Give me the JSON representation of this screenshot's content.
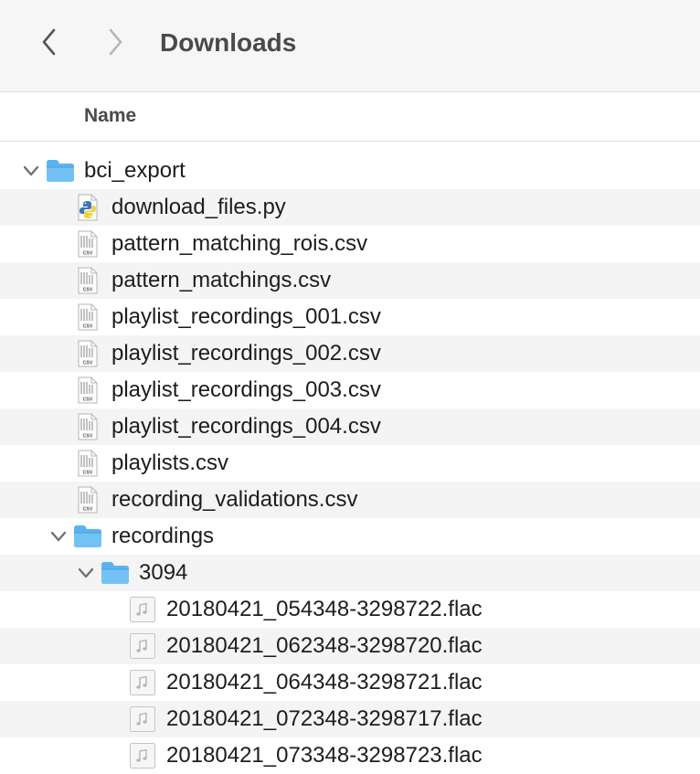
{
  "window": {
    "title": "Downloads"
  },
  "toolbar": {
    "back_icon": "chevron-left-icon",
    "forward_icon": "chevron-right-icon"
  },
  "columns": {
    "name": "Name"
  },
  "colors": {
    "folder": "#5ab3f0",
    "row_alt": "#f4f4f5",
    "toolbar_bg": "#f6f6f6"
  },
  "rows": [
    {
      "name": "bci_export",
      "kind": "folder",
      "level": 0,
      "expanded": true,
      "icon": "folder-icon"
    },
    {
      "name": "download_files.py",
      "kind": "python",
      "level": 1,
      "icon": "python-file-icon"
    },
    {
      "name": "pattern_matching_rois.csv",
      "kind": "csv",
      "level": 1,
      "icon": "csv-file-icon",
      "icon_label": "CSV"
    },
    {
      "name": "pattern_matchings.csv",
      "kind": "csv",
      "level": 1,
      "icon": "csv-file-icon",
      "icon_label": "CSV"
    },
    {
      "name": "playlist_recordings_001.csv",
      "kind": "csv",
      "level": 1,
      "icon": "csv-file-icon",
      "icon_label": "CSV"
    },
    {
      "name": "playlist_recordings_002.csv",
      "kind": "csv",
      "level": 1,
      "icon": "csv-file-icon",
      "icon_label": "CSV"
    },
    {
      "name": "playlist_recordings_003.csv",
      "kind": "csv",
      "level": 1,
      "icon": "csv-file-icon",
      "icon_label": "CSV"
    },
    {
      "name": "playlist_recordings_004.csv",
      "kind": "csv",
      "level": 1,
      "icon": "csv-file-icon",
      "icon_label": "CSV"
    },
    {
      "name": "playlists.csv",
      "kind": "csv",
      "level": 1,
      "icon": "csv-file-icon",
      "icon_label": "CSV"
    },
    {
      "name": "recording_validations.csv",
      "kind": "csv",
      "level": 1,
      "icon": "csv-file-icon",
      "icon_label": "CSV"
    },
    {
      "name": "recordings",
      "kind": "folder",
      "level": 1,
      "expanded": true,
      "icon": "folder-icon"
    },
    {
      "name": "3094",
      "kind": "folder",
      "level": 2,
      "expanded": true,
      "icon": "folder-icon"
    },
    {
      "name": "20180421_054348-3298722.flac",
      "kind": "audio",
      "level": 3,
      "icon": "audio-file-icon"
    },
    {
      "name": "20180421_062348-3298720.flac",
      "kind": "audio",
      "level": 3,
      "icon": "audio-file-icon"
    },
    {
      "name": "20180421_064348-3298721.flac",
      "kind": "audio",
      "level": 3,
      "icon": "audio-file-icon"
    },
    {
      "name": "20180421_072348-3298717.flac",
      "kind": "audio",
      "level": 3,
      "icon": "audio-file-icon"
    },
    {
      "name": "20180421_073348-3298723.flac",
      "kind": "audio",
      "level": 3,
      "icon": "audio-file-icon"
    }
  ]
}
